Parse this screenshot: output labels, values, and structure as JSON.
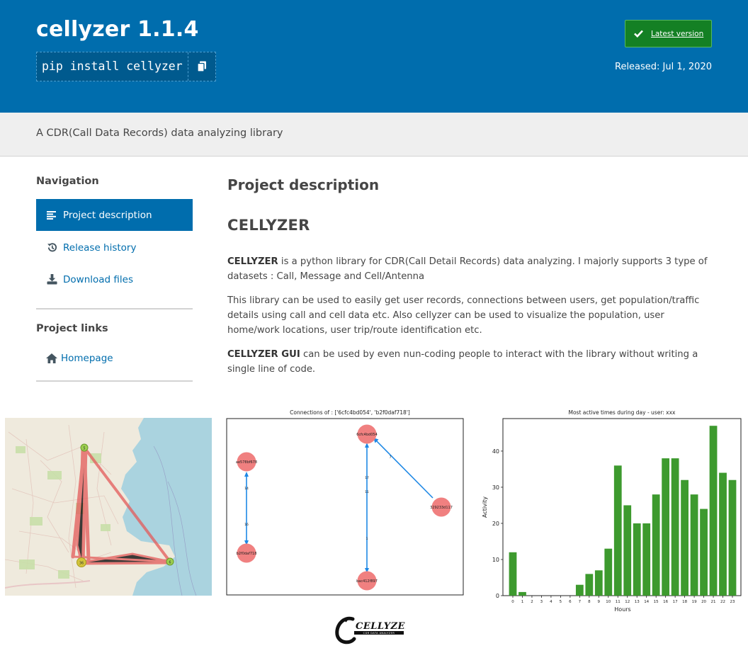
{
  "header": {
    "title": "cellyzer 1.1.4",
    "pip_command": "pip install cellyzer",
    "latest_version_label": "Latest version",
    "released": "Released: Jul 1, 2020",
    "colors": {
      "primary": "#006dad",
      "badge": "#148024"
    }
  },
  "summary": "A CDR(Call Data Records) data analyzing library",
  "sidebar": {
    "navigation_heading": "Navigation",
    "nav_items": [
      {
        "label": "Project description",
        "icon": "align-left-icon",
        "active": true
      },
      {
        "label": "Release history",
        "icon": "history-icon",
        "active": false
      },
      {
        "label": "Download files",
        "icon": "download-icon",
        "active": false
      }
    ],
    "links_heading": "Project links",
    "links": [
      {
        "label": "Homepage",
        "icon": "home-icon"
      }
    ]
  },
  "main": {
    "heading": "Project description",
    "readme_title": "CELLYZER",
    "p1_strong": "CELLYZER",
    "p1_rest": " is a python library for CDR(Call Detail Records) data analyzing. I majorly supports 3 type of datasets : Call, Message and Cell/Antenna",
    "p2": "This library can be used to easily get user records, connections between users, get population/traffic details using call and cell data etc. Also cellyzer can be used to visualize the population, user home/work locations, user trip/route identification etc.",
    "p3_strong": "CELLYZER GUI",
    "p3_rest": " can be used by even nun-coding people to interact with the library without writing a single line of code."
  },
  "map_figure": {
    "icon": "map-image",
    "markers": [
      "5",
      "36",
      "6"
    ]
  },
  "graph_figure": {
    "title": "Connections of : ['6cfc4bd054', 'b2f0daf718']",
    "nodes": [
      "6cfc4bd054",
      "ae578bf678",
      "329233d117",
      "b2f0daf718",
      "bac412f897"
    ],
    "edge_labels": [
      "14",
      "16",
      "17",
      "11",
      "1",
      "7"
    ]
  },
  "chart_data": {
    "type": "bar",
    "title": "Most active times during day - user: xxx",
    "xlabel": "Hours",
    "ylabel": "Activity",
    "categories": [
      "0",
      "1",
      "2",
      "3",
      "4",
      "5",
      "6",
      "7",
      "8",
      "9",
      "10",
      "11",
      "12",
      "13",
      "14",
      "15",
      "16",
      "17",
      "18",
      "19",
      "20",
      "21",
      "22",
      "23"
    ],
    "values": [
      12,
      1,
      0,
      0,
      0,
      0,
      0,
      3,
      6,
      7,
      13,
      36,
      25,
      20,
      20,
      28,
      38,
      38,
      32,
      28,
      24,
      47,
      34,
      32
    ],
    "ylim": [
      0,
      49
    ],
    "yticks": [
      0,
      10,
      20,
      30,
      40
    ],
    "color": "#3d9a2e",
    "grid": false
  },
  "logo": {
    "text": "CELLYZER",
    "tagline": "CDR DATA ANALYZER"
  }
}
